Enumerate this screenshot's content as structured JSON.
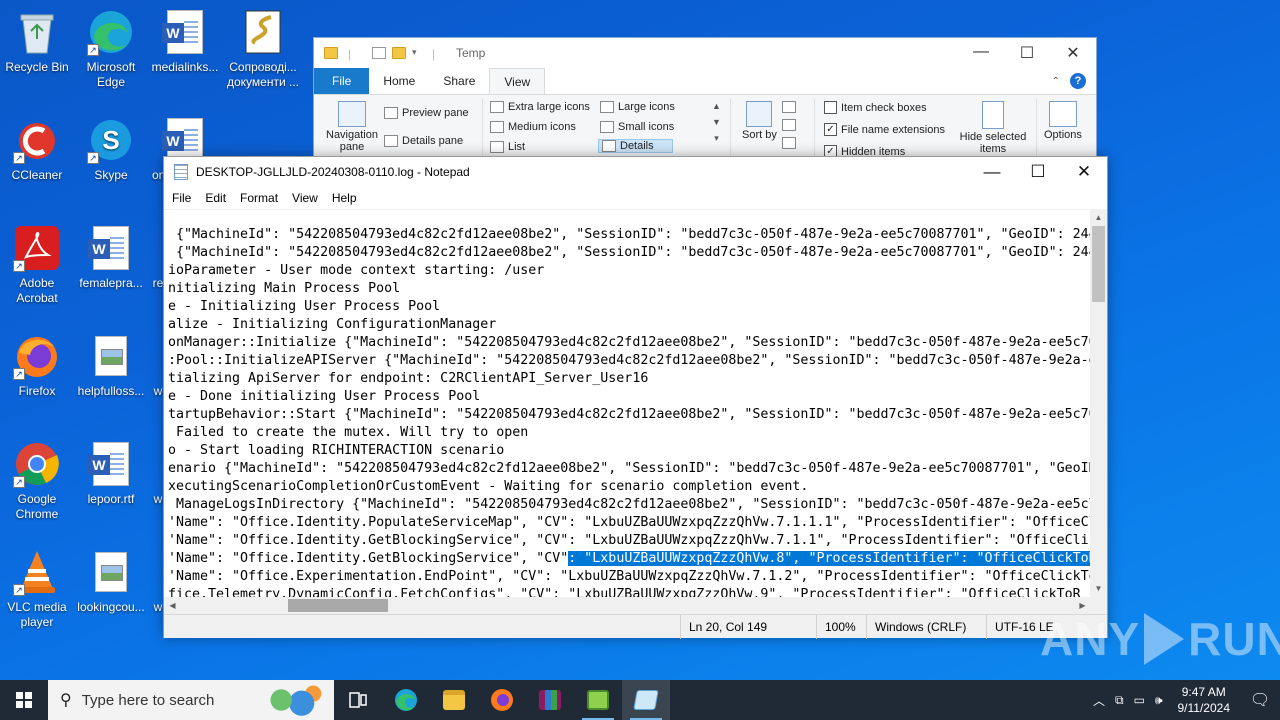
{
  "desktop": {
    "icons": [
      {
        "label": "Recycle Bin"
      },
      {
        "label": "Microsoft Edge"
      },
      {
        "label": "medialinks..."
      },
      {
        "label": "Сопроводі... документи ..."
      },
      {
        "label": "CCleaner"
      },
      {
        "label": "Skype"
      },
      {
        "label": "on"
      },
      {
        "label": "Adobe Acrobat"
      },
      {
        "label": "femalepra..."
      },
      {
        "label": "re"
      },
      {
        "label": "Firefox"
      },
      {
        "label": "helpfulloss..."
      },
      {
        "label": "w"
      },
      {
        "label": "Google Chrome"
      },
      {
        "label": "lepoor.rtf"
      },
      {
        "label": "w"
      },
      {
        "label": "VLC media player"
      },
      {
        "label": "lookingcou..."
      },
      {
        "label": "w"
      }
    ]
  },
  "explorer": {
    "title": "Temp",
    "tabs": {
      "file": "File",
      "home": "Home",
      "share": "Share",
      "view": "View"
    },
    "ribbon": {
      "navigation_pane": "Navigation pane",
      "preview_pane": "Preview pane",
      "details_pane": "Details pane",
      "extra_large_icons": "Extra large icons",
      "large_icons": "Large icons",
      "medium_icons": "Medium icons",
      "small_icons": "Small icons",
      "list": "List",
      "details": "Details",
      "sort_by": "Sort by",
      "item_check_boxes": "Item check boxes",
      "file_name_extensions": "File name extensions",
      "hidden_items": "Hidden items",
      "hide_selected_items": "Hide selected items",
      "options": "Options"
    },
    "checkboxes": {
      "item_check_boxes": false,
      "file_name_extensions": true,
      "hidden_items": true
    }
  },
  "notepad": {
    "title": "DESKTOP-JGLLJLD-20240308-0110.log - Notepad",
    "menu": [
      "File",
      "Edit",
      "Format",
      "View",
      "Help"
    ],
    "lines": [
      " {\"MachineId\": \"542208504793ed4c82c2fd12aee08be2\", \"SessionID\": \"bedd7c3c-050f-487e-9e2a-ee5c70087701\", \"GeoID\": 244,",
      " {\"MachineId\": \"542208504793ed4c82c2fd12aee08be2\", \"SessionID\": \"bedd7c3c-050f-487e-9e2a-ee5c70087701\", \"GeoID\": 244,",
      "ioParameter - User mode context starting: /user",
      "nitializing Main Process Pool",
      "e - Initializing User Process Pool",
      "alize - Initializing ConfigurationManager",
      "onManager::Initialize {\"MachineId\": \"542208504793ed4c82c2fd12aee08be2\", \"SessionID\": \"bedd7c3c-050f-487e-9e2a-ee5c70",
      ":Pool::InitializeAPIServer {\"MachineId\": \"542208504793ed4c82c2fd12aee08be2\", \"SessionID\": \"bedd7c3c-050f-487e-9e2a-e",
      "tializing ApiServer for endpoint: C2RClientAPI_Server_User16",
      "e - Done initializing User Process Pool",
      "tartupBehavior::Start {\"MachineId\": \"542208504793ed4c82c2fd12aee08be2\", \"SessionID\": \"bedd7c3c-050f-487e-9e2a-ee5c70",
      " Failed to create the mutex. Will try to open",
      "o - Start loading RICHINTERACTION scenario",
      "enario {\"MachineId\": \"542208504793ed4c82c2fd12aee08be2\", \"SessionID\": \"bedd7c3c-050f-487e-9e2a-ee5c70087701\", \"GeoID",
      "xecutingScenarioCompletionOrCustomEvent - Waiting for scenario completion event.",
      " ManageLogsInDirectory {\"MachineId\": \"542208504793ed4c82c2fd12aee08be2\", \"SessionID\": \"bedd7c3c-050f-487e-9e2a-ee5c7",
      "'Name\": \"Office.Identity.PopulateServiceMap\", \"CV\": \"LxbuUZBaUUWzxpqZzzQhVw.7.1.1.1\", \"ProcessIdentifier\": \"OfficeCl",
      "'Name\": \"Office.Identity.GetBlockingService\", \"CV\": \"LxbuUZBaUUWzxpqZzzQhVw.7.1.1\", \"ProcessIdentifier\": \"OfficeClic"
    ],
    "line19_pre": "'Name\": \"Office.Identity.GetBlockingService\", \"CV\"",
    "line19_sel": ": \"LxbuUZBaUUWzxpqZzzQhVw.8\", \"ProcessIdentifier\": \"OfficeClickToR",
    "line20": "'Name\": \"Office.Experimentation.EndPoint\", \"CV\": \"LxbuUZBaUUWzxpqZzzQhVw.7.1.2\", \"ProcessIdentifier\": \"OfficeClickTo",
    "line21": "fice.Telemetry.DynamicConfig.FetchConfigs\", \"CV\": \"LxbuUZBaUUWzxpqZzzQhVw.9\", \"ProcessIdentifier\": \"OfficeClickToR",
    "status": {
      "position": "Ln 20, Col 149",
      "zoom": "100%",
      "line_endings": "Windows (CRLF)",
      "encoding": "UTF-16 LE"
    }
  },
  "watermark": {
    "left": "ANY",
    "right": "RUN"
  },
  "taskbar": {
    "search_placeholder": "Type here to search",
    "time": "9:47 AM",
    "date": "9/11/2024"
  },
  "colors": {
    "accent": "#0078d7",
    "file_tab": "#1979ca",
    "taskbar": "#202a36",
    "desktop": "#0b63d8"
  }
}
